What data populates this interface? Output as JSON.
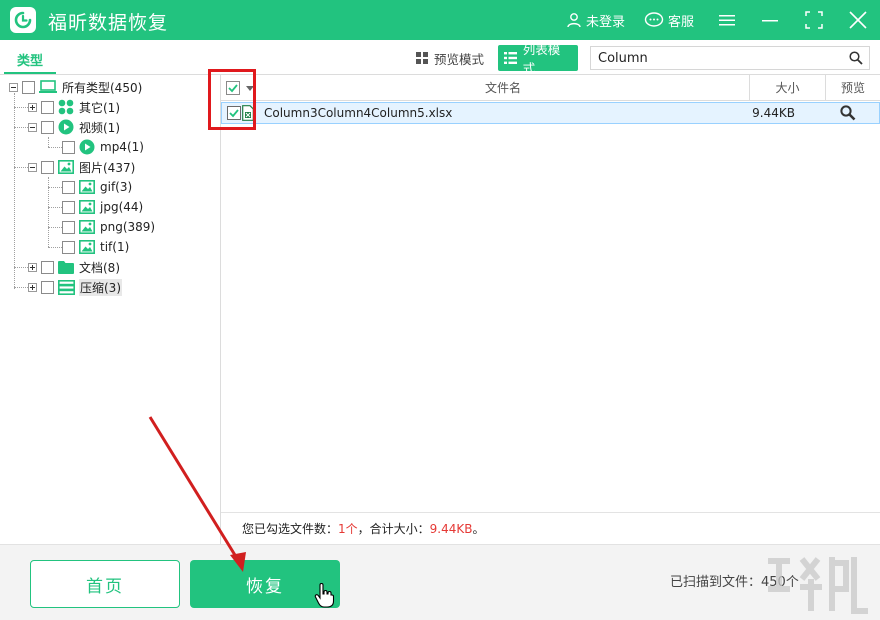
{
  "app": {
    "title": "福昕数据恢复",
    "login_label": "未登录",
    "service_label": "客服"
  },
  "toolbar": {
    "type_tab": "类型",
    "preview_mode": "预览模式",
    "list_mode": "列表模式",
    "search_value": "Column"
  },
  "tree": {
    "root": "所有类型(450)",
    "other": "其它(1)",
    "video": "视频(1)",
    "mp4": "mp4(1)",
    "image": "图片(437)",
    "gif": "gif(3)",
    "jpg": "jpg(44)",
    "png": "png(389)",
    "tif": "tif(1)",
    "doc": "文档(8)",
    "archive": "压缩(3)"
  },
  "table": {
    "col_name": "文件名",
    "col_size": "大小",
    "col_preview": "预览",
    "rows": [
      {
        "name": "Column3Column4Column5.xlsx",
        "size": "9.44KB",
        "checked": true
      }
    ]
  },
  "status": {
    "prefix": "您已勾选文件数：",
    "count": "1个",
    "middle": "，合计大小：",
    "size": "9.44KB",
    "suffix": "。"
  },
  "bottom": {
    "home": "首页",
    "recover": "恢复",
    "scanned": "已扫描到文件：450个"
  },
  "colors": {
    "accent": "#22c37f",
    "highlight": "#e53935",
    "selected_row": "#e5f3ff"
  },
  "icons": [
    "app-logo-icon",
    "user-icon",
    "chat-icon",
    "menu-icon",
    "minimize-icon",
    "maximize-icon",
    "close-icon",
    "grid-icon",
    "list-icon",
    "search-icon",
    "computer-icon",
    "xlsx-file-icon",
    "cursor-hand-icon"
  ]
}
